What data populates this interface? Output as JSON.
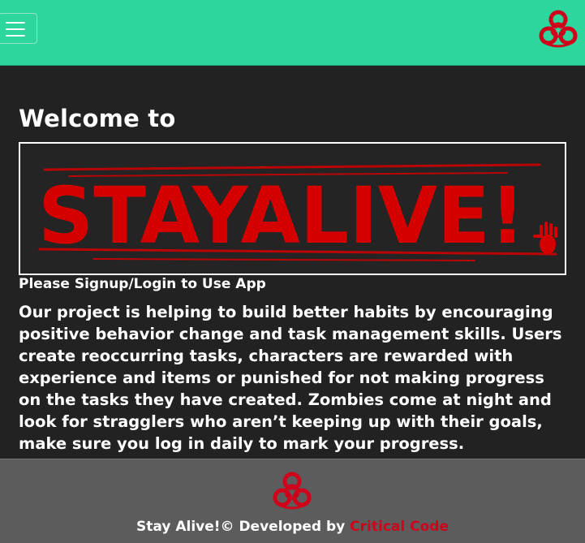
{
  "navbar": {
    "toggle_icon": "hamburger-menu-icon",
    "logo_icon": "biohazard-icon",
    "accent_color": "#2cd69c",
    "logo_color": "#d0021b"
  },
  "main": {
    "welcome": "Welcome to",
    "banner_text": "STAYALIVE!",
    "banner_color": "#d40000",
    "signup": "Please Signup/Login to Use App",
    "description": "Our project is helping to build better habits by encouraging positive behavior change and task management skills. Users create reoccurring tasks, characters are rewarded with experience and items or punished for not making progress on the tasks they have created. Zombies come at night and look for stragglers who aren’t keeping up with their goals, make sure you log in daily to mark your progress."
  },
  "footer": {
    "logo_icon": "biohazard-icon",
    "text": "Stay Alive!© Developed by ",
    "link": "Critical Code",
    "link_color": "#d0021b"
  }
}
